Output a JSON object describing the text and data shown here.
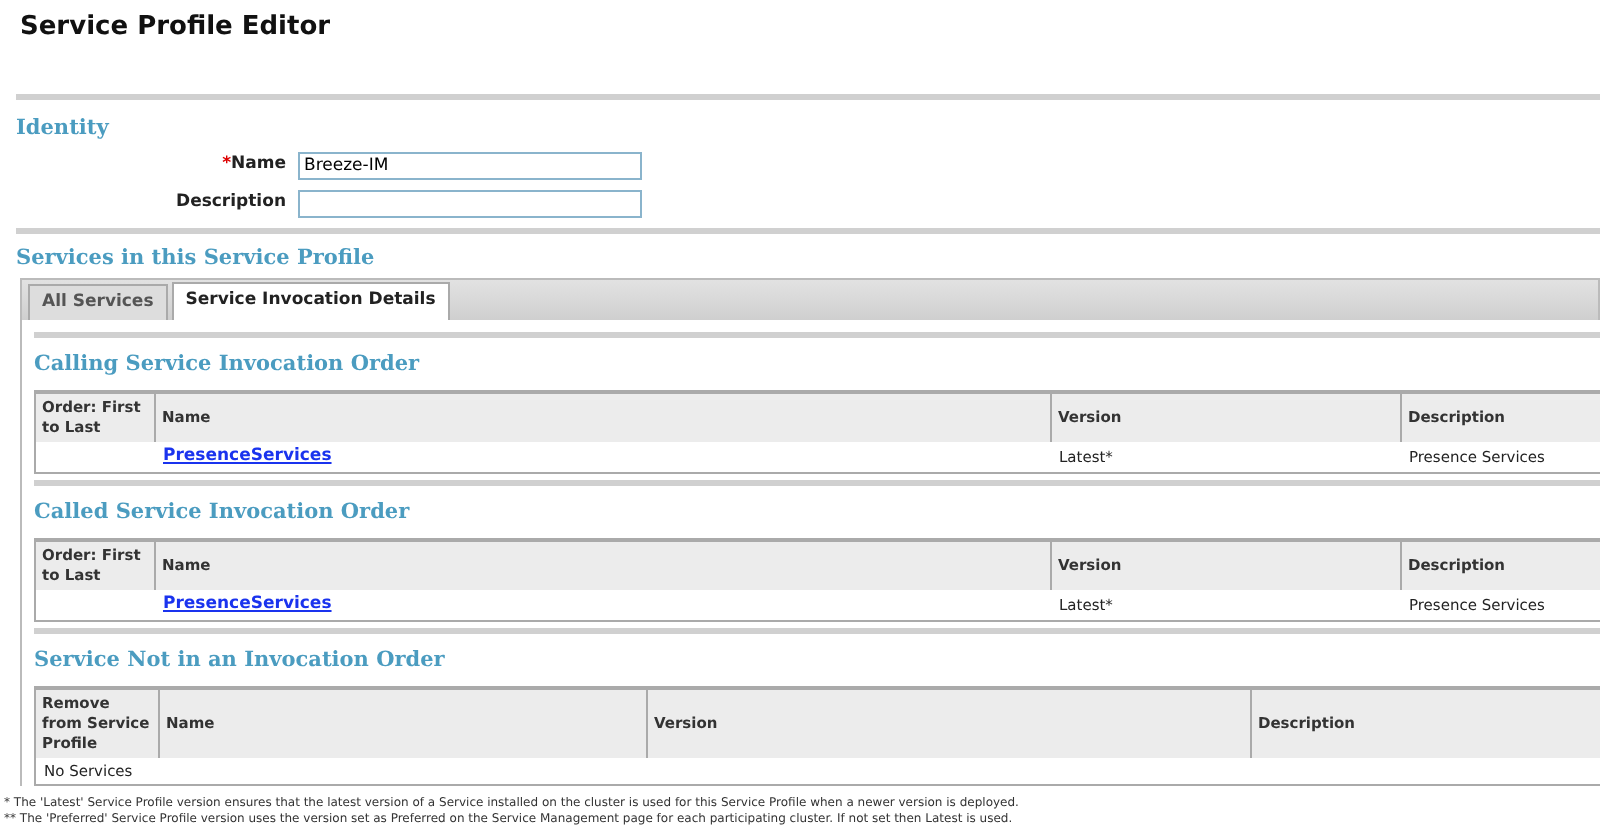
{
  "title": "Service Profile Editor",
  "identity": {
    "heading": "Identity",
    "fields": [
      {
        "label": "Name",
        "required_mark": "*",
        "value": "Breeze-IM"
      },
      {
        "label": "Description"
      }
    ]
  },
  "services": {
    "heading": "Services in this Service Profile",
    "tabs": [
      {
        "label": "All Services",
        "selected": false
      },
      {
        "label": "Service Invocation Details",
        "selected": true
      }
    ],
    "sections": [
      {
        "heading": "Calling Service Invocation Order",
        "columns": [
          "Order: First to Last",
          "Name",
          "Version",
          "Description"
        ],
        "rows": [
          {
            "cells": [
              null,
              {
                "text": "PresenceServices",
                "kind": "link"
              },
              {
                "text": "Latest*",
                "kind": "text"
              },
              {
                "text": "Presence Services",
                "kind": "text"
              }
            ]
          }
        ]
      },
      {
        "heading": "Called Service Invocation Order",
        "columns": [
          "Order: First to Last",
          "Name",
          "Version",
          "Description"
        ],
        "rows": [
          {
            "cells": [
              null,
              {
                "text": "PresenceServices",
                "kind": "link"
              },
              {
                "text": "Latest*",
                "kind": "text"
              },
              {
                "text": "Presence Services",
                "kind": "text"
              }
            ]
          }
        ]
      },
      {
        "heading": "Service Not in an Invocation Order",
        "columns": [
          "Remove from Service Profile",
          "Name",
          "Version",
          "Description"
        ],
        "empty_message": "No Services"
      }
    ]
  },
  "footnotes": [
    "* The 'Latest' Service Profile version ensures that the latest version of a Service installed on the cluster is used for this Service Profile when a newer version is deployed.",
    "** The 'Preferred' Service Profile version uses the version set as Preferred on the Service Management page for each participating cluster. If not set then Latest is used."
  ]
}
